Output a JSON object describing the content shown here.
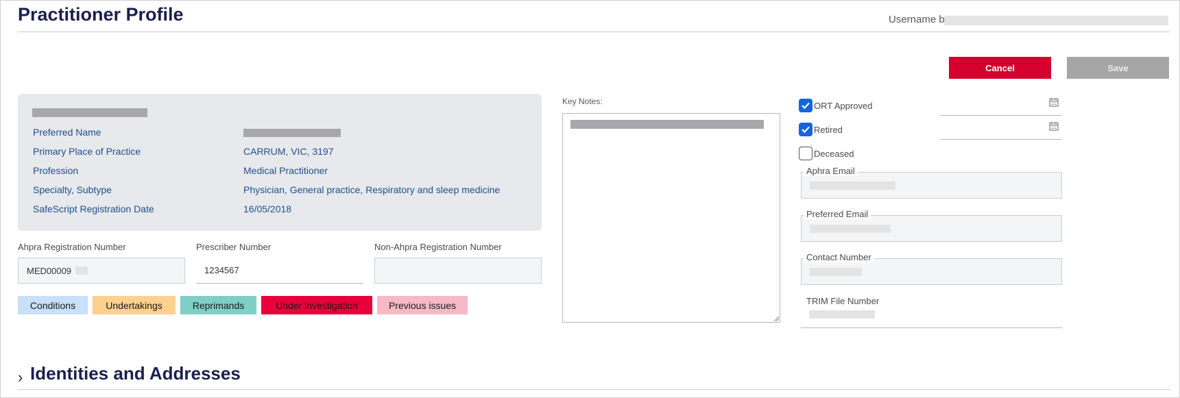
{
  "header": {
    "title": "Practitioner Profile",
    "username_label": "Username b"
  },
  "actions": {
    "cancel_label": "Cancel",
    "save_label": "Save"
  },
  "summary": {
    "rows": [
      {
        "label": "Preferred Name",
        "value": ""
      },
      {
        "label": "Primary Place of Practice",
        "value": "CARRUM, VIC, 3197"
      },
      {
        "label": "Profession",
        "value": "Medical Practitioner"
      },
      {
        "label": "Specialty, Subtype",
        "value": "Physician, General practice, Respiratory and sleep medicine"
      },
      {
        "label": "SafeScript Registration Date",
        "value": "16/05/2018"
      }
    ]
  },
  "registration": {
    "ahpra_label": "Ahpra Registration Number",
    "ahpra_value": "MED00009",
    "prescriber_label": "Prescriber Number",
    "prescriber_value": "1234567",
    "non_ahpra_label": "Non-Ahpra Registration Number",
    "non_ahpra_value": ""
  },
  "tags": [
    {
      "label": "Conditions",
      "color": "#c8e0f8"
    },
    {
      "label": "Undertakings",
      "color": "#fcd08f"
    },
    {
      "label": "Reprimands",
      "color": "#7fcfc6"
    },
    {
      "label": "Under investigation",
      "color": "#e8003a"
    },
    {
      "label": "Previous issues",
      "color": "#f6b9c6"
    }
  ],
  "key_notes": {
    "label": "Key Notes:"
  },
  "flags": {
    "ort_approved": {
      "label": "ORT Approved",
      "checked": true
    },
    "retired": {
      "label": "Retired",
      "checked": true
    },
    "deceased": {
      "label": "Deceased",
      "checked": false
    }
  },
  "contact": {
    "aphra_email_label": "Aphra Email",
    "preferred_email_label": "Preferred Email",
    "contact_number_label": "Contact Number",
    "trim_file_label": "TRIM File Number"
  },
  "sections": {
    "identities_title": "Identities and Addresses"
  },
  "colors": {
    "brand_navy": "#1c1f4d",
    "cancel_red": "#d6002e",
    "save_grey": "#a6a6a6",
    "link_blue": "#1f4e8c",
    "checkbox_blue": "#1565d8"
  }
}
